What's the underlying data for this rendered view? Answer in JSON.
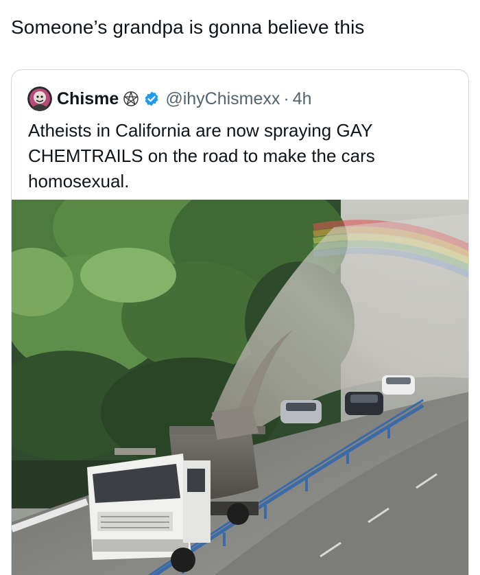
{
  "post": {
    "text": "Someone’s grandpa is gonna believe this"
  },
  "quote": {
    "display_name": "Chisme",
    "handle": "@ihyChismexx",
    "separator": "·",
    "time": "4h",
    "text": "Atheists in California are now spraying GAY CHEMTRAILS on the road to make the cars homosexual."
  },
  "icons": {
    "avatar": "avatar",
    "badge": "pentagram-icon",
    "verified": "verified-badge-icon"
  },
  "colors": {
    "verified_blue": "#1d9bf0",
    "border": "#cfd9de",
    "muted_text": "#536471",
    "text": "#0f1419"
  }
}
